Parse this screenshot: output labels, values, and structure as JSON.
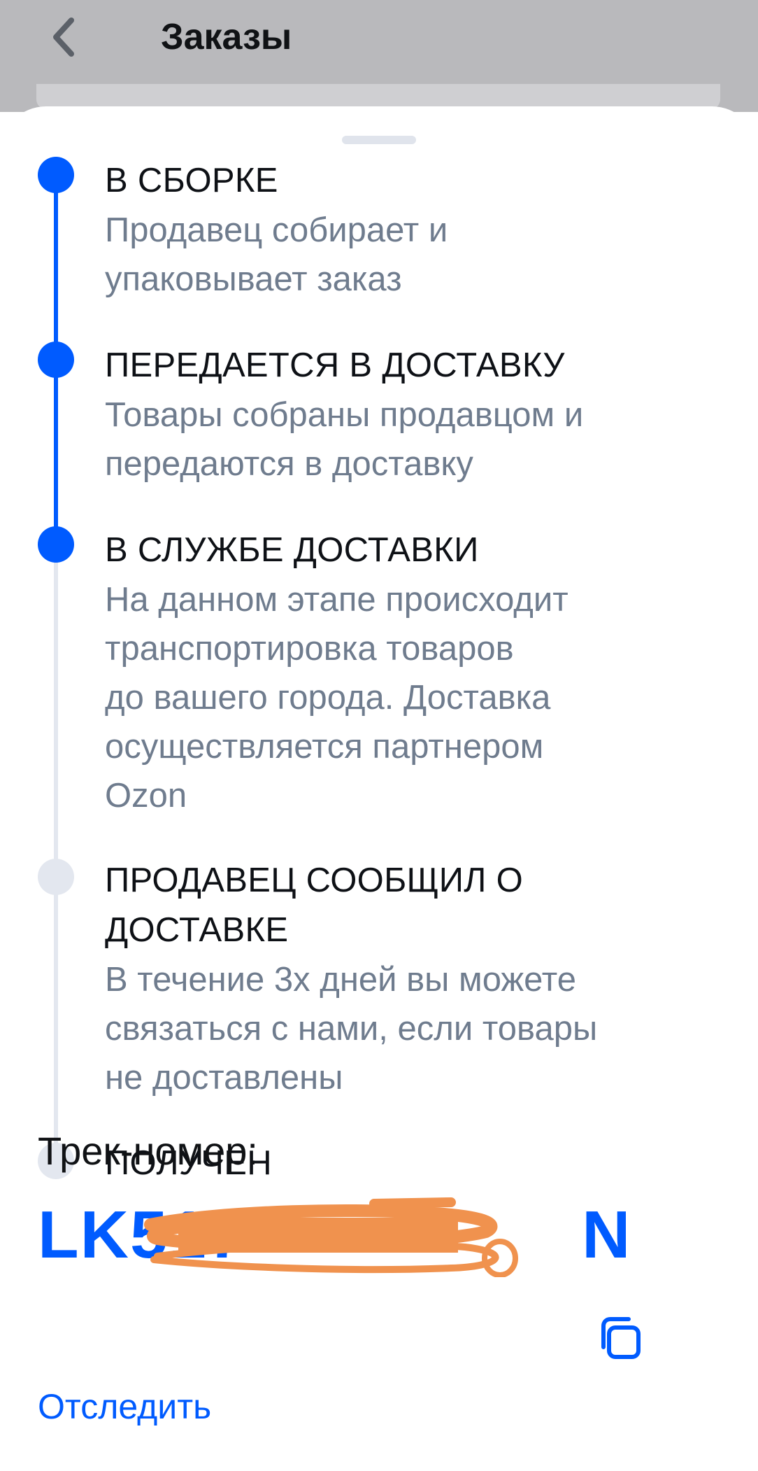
{
  "header": {
    "title": "Заказы",
    "back_icon": "chevron-left-icon"
  },
  "steps": [
    {
      "title": "В СБОРКЕ",
      "description_lines": [
        "Продавец собирает и",
        "упаковывает заказ"
      ],
      "status": "done"
    },
    {
      "title": "ПЕРЕДАЕТСЯ В ДОСТАВКУ",
      "description_lines": [
        "Товары собраны продавцом и",
        "передаются в доставку"
      ],
      "status": "done"
    },
    {
      "title": "В СЛУЖБЕ ДОСТАВКИ",
      "description_lines": [
        "На данном этапе происходит",
        "транспортировка товаров",
        "до вашего города. Доставка",
        "осуществляется партнером",
        "Ozon"
      ],
      "status": "current"
    },
    {
      "title_lines": [
        "ПРОДАВЕЦ СООБЩИЛ О",
        "ДОСТАВКЕ"
      ],
      "description_lines": [
        "В течение 3х дней вы можете",
        "связаться с нами, если товары",
        "не доставлены"
      ],
      "status": "pending"
    },
    {
      "title": "ПОЛУЧЕН",
      "status": "pending"
    }
  ],
  "tracking": {
    "label": "Трек-номер:",
    "number_visible": "LK517",
    "number_suffix": "N",
    "copy_icon": "copy-icon",
    "track_link": "Отследить"
  },
  "colors": {
    "accent": "#005bff",
    "inactive": "#e3e7ef",
    "muted_text": "#6f7c8e",
    "overlay": "#b9b9bc",
    "redaction": "#f0924e"
  }
}
